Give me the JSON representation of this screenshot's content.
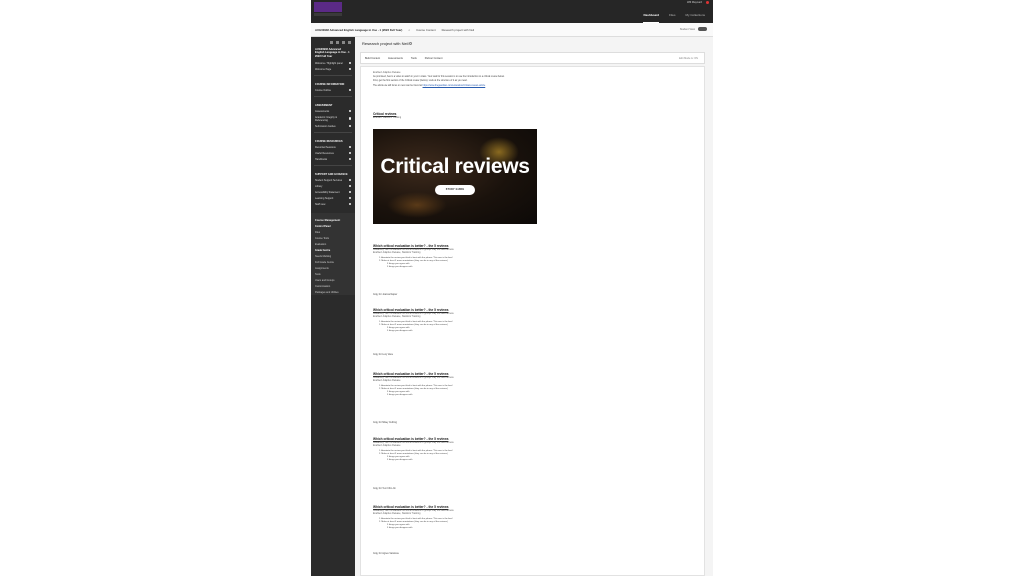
{
  "global_nav": {
    "items": [
      {
        "label": "Dashboard",
        "active": true
      },
      {
        "label": "Files",
        "active": false
      },
      {
        "label": "My Collections",
        "active": false
      }
    ],
    "user_name": "Will Maynard"
  },
  "course_bar": {
    "course_title": "AUG00902 Advanced English Language in Use - 1 (2022 Full Year)",
    "crumb1": "Course Content",
    "crumb2": "Research project with Neil",
    "student_view_label": "Student View"
  },
  "sidebar": {
    "course_name": "AUG00902 Advanced English Language in Use - 1 2022 Full Year",
    "top_items": [
      "Welcome / Highlight panel",
      "Welcome Page"
    ],
    "sections": [
      {
        "heading": "COURSE INFORMATION",
        "items": [
          "Course Outline"
        ]
      },
      {
        "heading": "ASSESSMENT",
        "items": [
          "Assessments",
          "Academic Integrity & Referencing",
          "Submission Guides"
        ]
      },
      {
        "heading": "COURSE RESOURCES",
        "items": [
          "Recorded Sessions",
          "Useful Resources",
          "Handbooks"
        ]
      },
      {
        "heading": "SUPPORT AND GUIDANCE",
        "items": [
          "Student Support Services",
          "Library",
          "Accessibility Statement",
          "Learning Support",
          "Staff view"
        ]
      }
    ],
    "course_management": {
      "heading": "Course Management",
      "items": [
        {
          "label": "Control Panel",
          "strong": true
        },
        {
          "label": "Files",
          "strong": false
        },
        {
          "label": "Course Tools",
          "strong": false
        },
        {
          "label": "Evaluation",
          "strong": false
        },
        {
          "label": "Grade Centre",
          "strong": true
        },
        {
          "label": "Needs Marking",
          "strong": false
        },
        {
          "label": "Full Grade Centre",
          "strong": false
        },
        {
          "label": "Assignments",
          "strong": false
        },
        {
          "label": "Tests",
          "strong": false
        },
        {
          "label": "Users and Groups",
          "strong": false
        },
        {
          "label": "Customisation",
          "strong": false
        },
        {
          "label": "Packages and Utilities",
          "strong": false
        }
      ]
    }
  },
  "page": {
    "title": "Research project with Neil",
    "tabs": [
      "Build Content",
      "Assessments",
      "Tools",
      "Partner Content"
    ],
    "edit_mode": "Edit Mode is: ON"
  },
  "content": {
    "intro": {
      "meta": "Enabled:  Adaptive Release",
      "text1": "As promised, here's a video to watch in your in class. Your task for this session is to use the introduction to a critical review below.",
      "text2": "First, get the first section of the Critical review (below). Look at the structure of it as you read.",
      "text3": "The article we will focus on next can be found at",
      "link": "https://www.theguardian.com/education/critical-reviews-article"
    },
    "critical_reviews": {
      "title": "Critical reviews",
      "meta": "Enabled:  Statistics Tracking",
      "banner_title": "Critical reviews",
      "banner_button": "STUDY GUIDE"
    },
    "blocks": [
      {
        "title": "Which critical evaluation is better? - the 5 reviews",
        "meta1": "Availability:  Item is available but some students or groups may not have access.",
        "meta2": "Enabled:  Adaptive Release, Statistics Tracking",
        "steps": [
          "1. Annotate the review you think is best with the phrase 'This one is the best'",
          "2. Make at least 3 more annotations (they can be in any of the reviews)"
        ],
        "bullets": [
          "3 things you agree with",
          "3 things you disagree with"
        ],
        "footer": "Copy for Joanna Napier"
      },
      {
        "title": "Which critical evaluation is better? - the 5 reviews",
        "meta1": "Availability:  Item is available but some students or groups may not have access.",
        "meta2": "Enabled:  Adaptive Release, Statistics Tracking",
        "steps": [
          "1. Annotate the review you think is best with the phrase 'This one is the best'",
          "2. Make at least 3 more annotations (they can be in any of the reviews)"
        ],
        "bullets": [
          "3 things you agree with",
          "3 things you disagree with"
        ],
        "footer": "Copy for Lucy Vane"
      },
      {
        "title": "Which critical evaluation is better? - the 5 reviews",
        "meta1": "Availability:  Item is available but some students or groups may not have access.",
        "meta2": "Enabled:  Adaptive Release",
        "steps": [
          "1. Annotate the review you think is best with the phrase 'This one is the best'",
          "2. Make at least 3 more annotations (they can be in any of the reviews)"
        ],
        "bullets": [
          "3 things you agree with",
          "3 things you disagree with"
        ],
        "footer": "Copy for Mikey Cuthing"
      },
      {
        "title": "Which critical evaluation is better? - the 5 reviews",
        "meta1": "Availability:  Item is available but some students or groups may not have access.",
        "meta2": "Enabled:  Adaptive Release",
        "steps": [
          "1. Annotate the review you think is best with the phrase 'This one is the best'",
          "2. Make at least 3 more annotations (they can be in any of the reviews)"
        ],
        "bullets": [
          "3 things you agree with",
          "3 things you disagree with"
        ],
        "footer": "Copy for Yuxi Chin-Jin"
      },
      {
        "title": "Which critical evaluation is better? - the 5 reviews",
        "meta1": "Availability:  Item is available but some students or groups may not have access.",
        "meta2": "Enabled:  Adaptive Release, Statistics Tracking",
        "steps": [
          "1. Annotate the review you think is best with the phrase 'This one is the best'",
          "2. Make at least 3 more annotations (they can be in any of the reviews)"
        ],
        "bullets": [
          "3 things you agree with",
          "3 things you disagree with"
        ],
        "footer": "Copy for Agnes Vanstone"
      }
    ]
  }
}
